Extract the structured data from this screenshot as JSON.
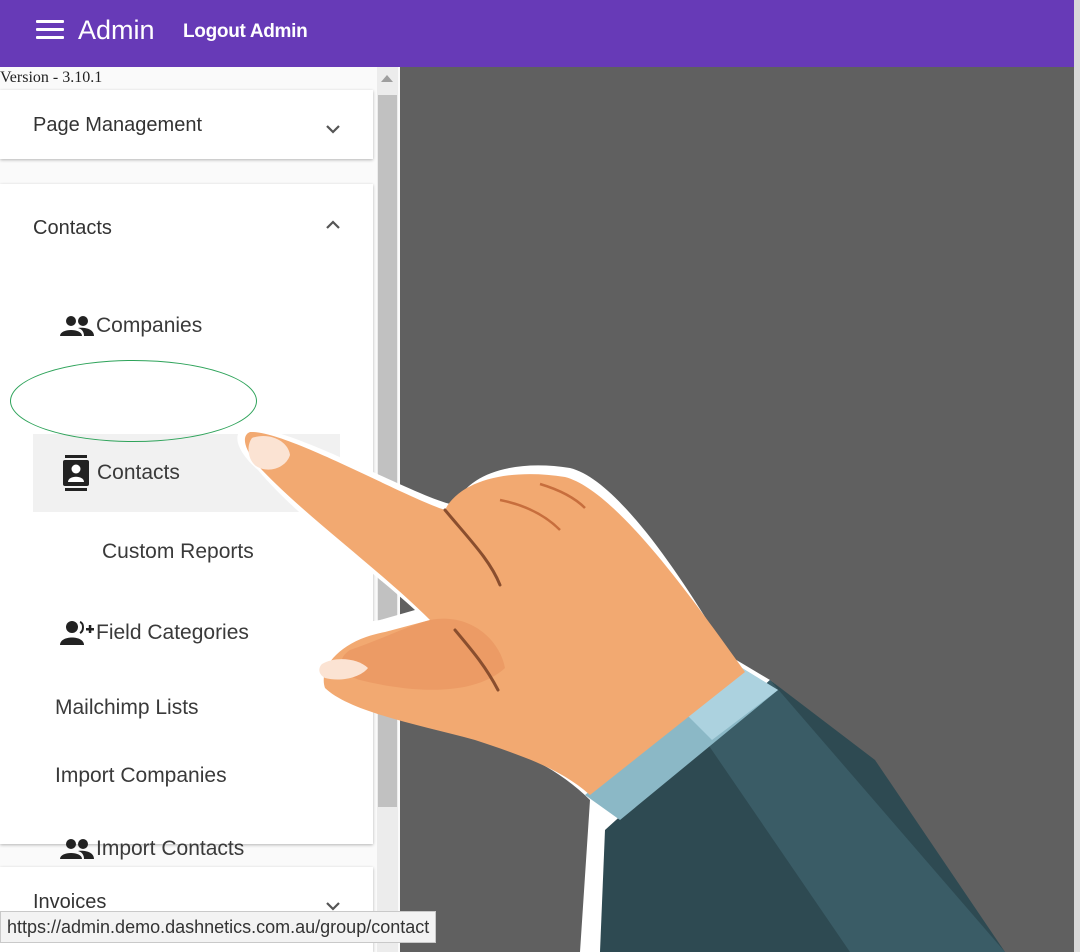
{
  "header": {
    "menu_icon": "menu-icon",
    "brand": "Admin",
    "logout_label": "Logout Admin",
    "bg_color": "#673ab7"
  },
  "sidebar": {
    "version": "Version - 3.10.1",
    "sections": [
      {
        "title": "Page Management",
        "expanded": false,
        "chevron": "chevron-down-icon"
      },
      {
        "title": "Contacts",
        "expanded": true,
        "chevron": "chevron-up-icon",
        "items": [
          {
            "label": "Companies",
            "icon": "people-icon"
          },
          {
            "label": "Contacts",
            "icon": "contact-card-icon",
            "active": true
          },
          {
            "label": "Custom Reports",
            "icon": ""
          },
          {
            "label": "Field Categories",
            "icon": "person-add-icon"
          },
          {
            "label": "Mailchimp Lists",
            "icon": ""
          },
          {
            "label": "Import Companies",
            "icon": ""
          },
          {
            "label": "Import Contacts",
            "icon": "people-icon"
          }
        ]
      },
      {
        "title": "Invoices",
        "expanded": false,
        "chevron": "chevron-down-icon"
      }
    ]
  },
  "statusbar": {
    "url": "https://admin.demo.dashnetics.com.au/group/contact"
  },
  "overlay": {
    "highlight_color": "#2ea35a",
    "pointer": "pointing-hand-illustration"
  }
}
